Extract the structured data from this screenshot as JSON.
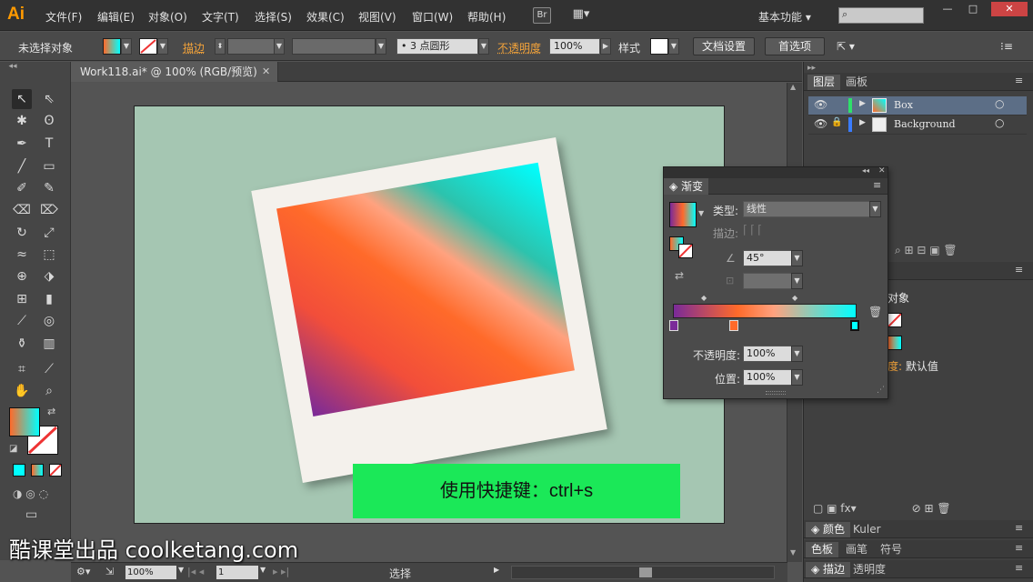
{
  "app": {
    "logo": "Ai",
    "menu": [
      "文件(F)",
      "编辑(E)",
      "对象(O)",
      "文字(T)",
      "选择(S)",
      "效果(C)",
      "视图(V)",
      "窗口(W)",
      "帮助(H)"
    ],
    "bridge_label": "Br",
    "workspace": "基本功能",
    "window_controls": [
      "—",
      "□",
      "✕"
    ]
  },
  "control_bar": {
    "selection_status": "未选择对象",
    "stroke_label": "描边",
    "brush_value": "3 点圆形",
    "opacity_label": "不透明度",
    "opacity_value": "100%",
    "style_label": "样式",
    "doc_settings_button": "文档设置",
    "preferences_button": "首选项"
  },
  "document": {
    "tab_title": "Work118.ai* @ 100% (RGB/预览)",
    "caption": "使用快捷键：ctrl+s"
  },
  "status_bar": {
    "zoom": "100%",
    "artboard_number": "1",
    "tool_status": "选择"
  },
  "layers_panel": {
    "tabs": [
      "图层",
      "画板"
    ],
    "layers": [
      {
        "name": "Box",
        "color": "#2fe06a",
        "selected": true,
        "locked": false
      },
      {
        "name": "Background",
        "color": "#3a7cff",
        "selected": false,
        "locked": true
      }
    ]
  },
  "appearance_panel": {
    "title": "对象",
    "opacity_label": "度:",
    "opacity_value": "默认值"
  },
  "bottom_panels": {
    "row1": [
      "颜色",
      "Kuler"
    ],
    "row2": [
      "色板",
      "画笔",
      "符号"
    ],
    "row3": [
      "描边",
      "透明度"
    ]
  },
  "gradient_panel": {
    "title": "渐变",
    "type_label": "类型:",
    "type_value": "线性",
    "stroke_label": "描边:",
    "angle_value": "45°",
    "opacity_label": "不透明度:",
    "opacity_value": "100%",
    "position_label": "位置:",
    "position_value": "100%",
    "stops": [
      "#7a2a99",
      "#ff6a2a",
      "#00ffff"
    ]
  },
  "watermark": "酷课堂出品 coolketang.com",
  "colors": {
    "artboard": "#a5c6b2",
    "caption_bg": "#1be858",
    "accent_orange": "#f3a33a"
  }
}
